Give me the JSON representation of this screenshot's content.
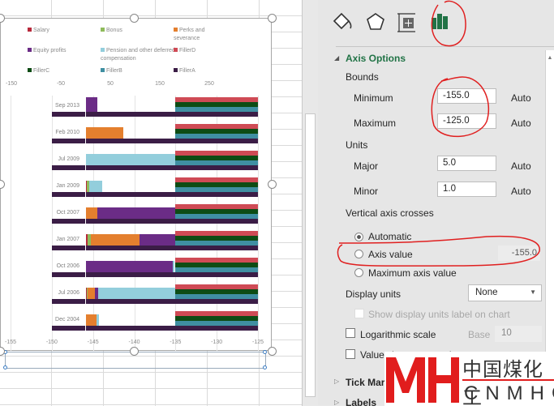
{
  "chart": {
    "legend": [
      {
        "label": "Salary",
        "color": "#b8293b"
      },
      {
        "label": "Bonus",
        "color": "#8fbb5b"
      },
      {
        "label": "Perks and severance",
        "color": "#e47f2e"
      },
      {
        "label": "Equity profits",
        "color": "#6b2c86"
      },
      {
        "label": "Pension and other deferred compensation",
        "color": "#93cedc"
      },
      {
        "label": "FillerD",
        "color": "#cf4a55"
      },
      {
        "label": "FillerC",
        "color": "#0d4c14"
      },
      {
        "label": "FillerB",
        "color": "#3f8fa2"
      },
      {
        "label": "FillerA",
        "color": "#3b1d46"
      }
    ],
    "top_ticks": [
      "-150",
      "-50",
      "50",
      "150",
      "250"
    ],
    "bottom_ticks": [
      "-155",
      "-150",
      "-145",
      "-140",
      "-135",
      "-130",
      "-125"
    ]
  },
  "chart_data": {
    "type": "bar",
    "orientation": "horizontal-stacked",
    "xlim": [
      -155,
      -125
    ],
    "secondary_xlim": [
      -150,
      250
    ],
    "base": -146,
    "categories": [
      "Sep 2013",
      "Feb 2010",
      "Jul 2009",
      "Jan 2009",
      "Oct 2007",
      "Jan 2007",
      "Oct 2006",
      "Jul 2006",
      "Dec 2004"
    ],
    "series": [
      {
        "name": "Salary",
        "values": [
          0.15,
          0,
          0,
          0.2,
          0,
          0.3,
          0,
          0.2,
          0
        ]
      },
      {
        "name": "Bonus",
        "values": [
          0,
          0,
          0,
          0.3,
          0,
          0.4,
          0,
          0.1,
          0
        ]
      },
      {
        "name": "Perks and severance",
        "values": [
          0,
          4.7,
          0,
          0,
          1.5,
          5.9,
          0,
          0.9,
          1.4
        ]
      },
      {
        "name": "Equity profits",
        "values": [
          1.4,
          0,
          0,
          0,
          9.5,
          4.4,
          10.7,
          0.4,
          0
        ]
      },
      {
        "name": "Pension and other deferred compensation",
        "values": [
          0,
          0,
          11,
          1.6,
          0,
          0,
          0.2,
          9.4,
          0.3
        ]
      }
    ],
    "fillers": {
      "FillerD": [
        -135,
        -125
      ],
      "FillerC": [
        -135,
        -125
      ],
      "FillerB": [
        -135,
        -125
      ],
      "FillerA": [
        -150,
        -125
      ]
    }
  },
  "panel": {
    "section_title": "Axis Options",
    "bounds_label": "Bounds",
    "minimum_label": "Minimum",
    "minimum_value": "-155.0",
    "maximum_label": "Maximum",
    "maximum_value": "-125.0",
    "units_label": "Units",
    "major_label": "Major",
    "major_value": "5.0",
    "minor_label": "Minor",
    "minor_value": "1.0",
    "auto": "Auto",
    "vac_label": "Vertical axis crosses",
    "automatic": "Automatic",
    "axis_value": "Axis value",
    "axis_value_value": "-155.0",
    "max_axis_value": "Maximum axis value",
    "display_units_label": "Display units",
    "display_units_value": "None",
    "show_units_label": "Show display units label on chart",
    "log_scale": "Logarithmic scale",
    "base_label": "Base",
    "base_value": "10",
    "values_reverse": "Values in reverse order",
    "tick_marks": "Tick Marks",
    "labels": "Labels"
  },
  "watermark": {
    "mark": "MH",
    "cn": "中国煤化工",
    "en": "CNMHG"
  }
}
